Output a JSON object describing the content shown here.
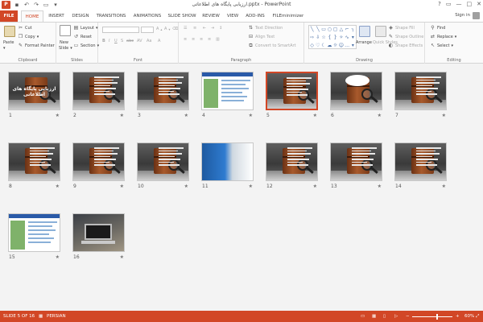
{
  "window": {
    "title": "ارزیابی پایگاه های اطلاعاتی.pptx - PowerPoint",
    "app_icon": "P",
    "controls": [
      "?",
      "▭",
      "—",
      "□",
      "✕"
    ]
  },
  "tabs": [
    "FILE",
    "HOME",
    "INSERT",
    "DESIGN",
    "TRANSITIONS",
    "ANIMATIONS",
    "SLIDE SHOW",
    "REVIEW",
    "VIEW",
    "ADD-INS",
    "FILEminimizer"
  ],
  "active_tab": "HOME",
  "signin": "Sign in",
  "ribbon": {
    "clipboard": {
      "label": "Clipboard",
      "paste": "Paste",
      "cut": "Cut",
      "copy": "Copy",
      "format_painter": "Format Painter"
    },
    "slides": {
      "label": "Slides",
      "new_slide": "New",
      "new_slide2": "Slide",
      "layout": "Layout",
      "reset": "Reset",
      "section": "Section"
    },
    "font": {
      "label": "Font"
    },
    "paragraph": {
      "label": "Paragraph",
      "text_direction": "Text Direction",
      "align_text": "Align Text",
      "convert": "Convert to SmartArt"
    },
    "drawing": {
      "label": "Drawing",
      "arrange": "Arrange",
      "quick_styles": "Quick Styles",
      "shape_fill": "Shape Fill",
      "shape_outline": "Shape Outline",
      "shape_effects": "Shape Effects"
    },
    "editing": {
      "label": "Editing",
      "find": "Find",
      "replace": "Replace",
      "select": "Select"
    }
  },
  "slides": [
    {
      "num": "1",
      "kind": "title",
      "title": "ارزیابی پایگاه های اطلاعاتی"
    },
    {
      "num": "2",
      "kind": "text"
    },
    {
      "num": "3",
      "kind": "text"
    },
    {
      "num": "4",
      "kind": "web"
    },
    {
      "num": "5",
      "kind": "text",
      "selected": true
    },
    {
      "num": "6",
      "kind": "bubble"
    },
    {
      "num": "7",
      "kind": "text"
    },
    {
      "num": "8",
      "kind": "text"
    },
    {
      "num": "9",
      "kind": "text"
    },
    {
      "num": "10",
      "kind": "text"
    },
    {
      "num": "11",
      "kind": "blue"
    },
    {
      "num": "12",
      "kind": "text"
    },
    {
      "num": "13",
      "kind": "text"
    },
    {
      "num": "14",
      "kind": "text"
    },
    {
      "num": "15",
      "kind": "web"
    },
    {
      "num": "16",
      "kind": "photo"
    }
  ],
  "status": {
    "slide_info": "SLIDE 5 OF 16",
    "language": "PERSIAN",
    "zoom": "60%",
    "zoom_level_pct": 60
  }
}
